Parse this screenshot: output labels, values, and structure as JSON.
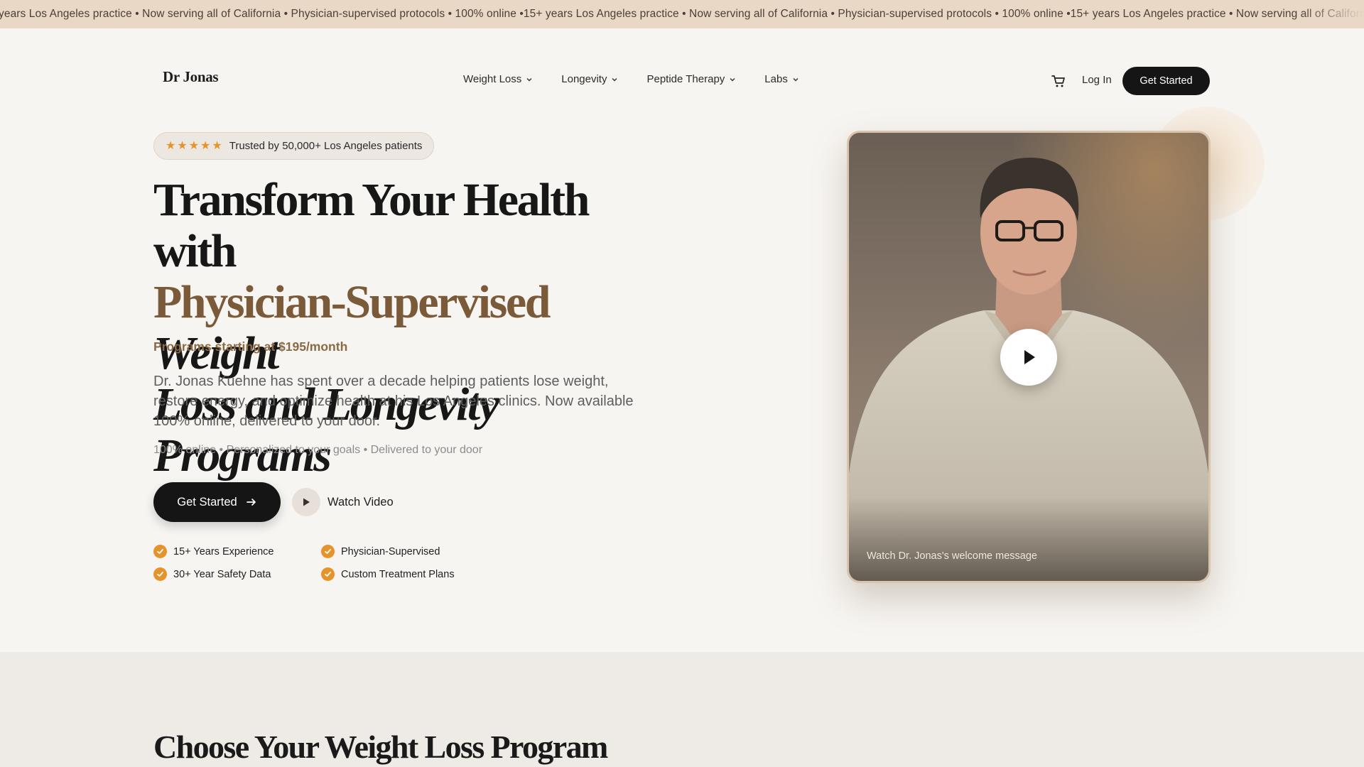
{
  "ticker": {
    "text": "years Los Angeles practice • Now serving all of California • Physician-supervised protocols • 100% online •15+ years Los Angeles practice • Now serving all of California • Physician-supervised protocols • 100% online •15+ years Los Angeles practice • Now serving all of California"
  },
  "brand": {
    "logo": "Dr Jonas"
  },
  "nav": {
    "items": [
      {
        "label": "Weight Loss"
      },
      {
        "label": "Longevity"
      },
      {
        "label": "Peptide Therapy"
      },
      {
        "label": "Labs"
      }
    ],
    "login": "Log In",
    "cta": "Get Started"
  },
  "hero": {
    "trust_badge": "Trusted by 50,000+ Los Angeles patients",
    "stars": 5,
    "headline_line1": "Transform Your Health with",
    "headline_accent": "Physician-Supervised",
    "headline_italic_1": "Weight",
    "headline_italic_2": "Loss and Longevity Programs",
    "price": "Programs starting at $195/month",
    "description": "Dr. Jonas Kuehne has spent over a decade helping patients lose weight, restore energy, and optimize health at his Los Angeles clinics. Now available 100% online, delivered to your door.",
    "subline": "100% online • Personalized to your goals • Delivered to your door",
    "cta": "Get Started",
    "watch": "Watch Video",
    "features": [
      "15+ Years Experience",
      "Physician-Supervised",
      "30+ Year Safety Data",
      "Custom Treatment Plans"
    ]
  },
  "video": {
    "caption": "Watch Dr. Jonas's welcome message"
  },
  "next_section": {
    "title": "Choose Your Weight Loss Program"
  },
  "colors": {
    "accent": "#7a5a38",
    "star": "#e6932a",
    "dark": "#151515",
    "ticker_bg": "#ead8c6"
  }
}
